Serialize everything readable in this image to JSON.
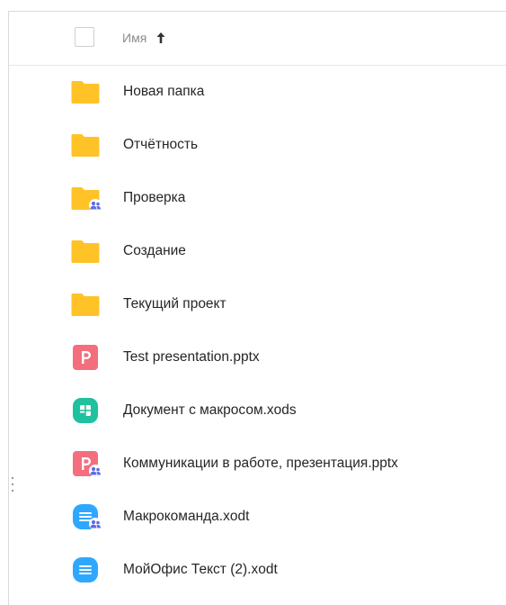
{
  "header": {
    "column_name": "Имя",
    "sort_direction": "ascending"
  },
  "colors": {
    "folder": "#FFC328",
    "presentation": "#F46E7D",
    "spreadsheet": "#1FC19F",
    "text": "#2EA7FF",
    "shared_badge": "#5E6BE7"
  },
  "files": [
    {
      "name": "Новая папка",
      "type": "folder",
      "shared": false
    },
    {
      "name": "Отчётность",
      "type": "folder",
      "shared": false
    },
    {
      "name": "Проверка",
      "type": "folder",
      "shared": true
    },
    {
      "name": "Создание",
      "type": "folder",
      "shared": false
    },
    {
      "name": "Текущий проект",
      "type": "folder",
      "shared": false
    },
    {
      "name": "Test presentation.pptx",
      "type": "presentation",
      "shared": false
    },
    {
      "name": "Документ с макросом.xods",
      "type": "spreadsheet",
      "shared": false
    },
    {
      "name": "Коммуникации в работе, презентация.pptx",
      "type": "presentation",
      "shared": true
    },
    {
      "name": "Макрокоманда.xodt",
      "type": "text",
      "shared": true
    },
    {
      "name": "МойОфис Текст (2).xodt",
      "type": "text",
      "shared": false
    }
  ]
}
